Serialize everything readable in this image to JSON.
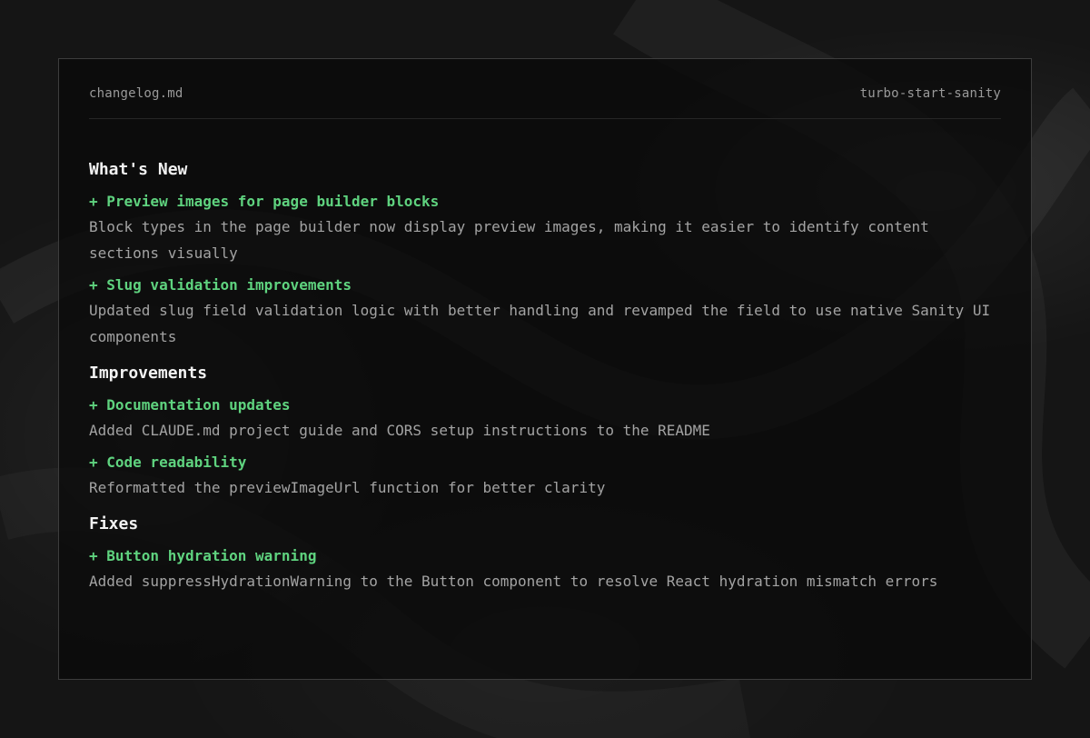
{
  "header": {
    "filename": "changelog.md",
    "project": "turbo-start-sanity"
  },
  "sections": [
    {
      "title": "What's New",
      "entries": [
        {
          "title": "+ Preview images for page builder blocks",
          "description": "Block types in the page builder now display preview images, making it easier to identify content sections visually"
        },
        {
          "title": "+ Slug validation improvements",
          "description": "Updated slug field validation logic with better handling and revamped the field to use native Sanity UI components"
        }
      ]
    },
    {
      "title": "Improvements",
      "entries": [
        {
          "title": "+ Documentation updates",
          "description": "Added CLAUDE.md project guide and CORS setup instructions to the README"
        },
        {
          "title": "+ Code readability",
          "description": "Reformatted the previewImageUrl function for better clarity"
        }
      ]
    },
    {
      "title": "Fixes",
      "entries": [
        {
          "title": "+ Button hydration warning",
          "description": "Added suppressHydrationWarning to the Button component to resolve React hydration mismatch errors"
        }
      ]
    }
  ],
  "colors": {
    "background": "#151515",
    "panel_border": "#3d3d3d",
    "heading": "#f2f2f2",
    "entry_title": "#5fd37f",
    "body_text": "#a3a3a3",
    "meta_text": "#9a9a9a"
  }
}
